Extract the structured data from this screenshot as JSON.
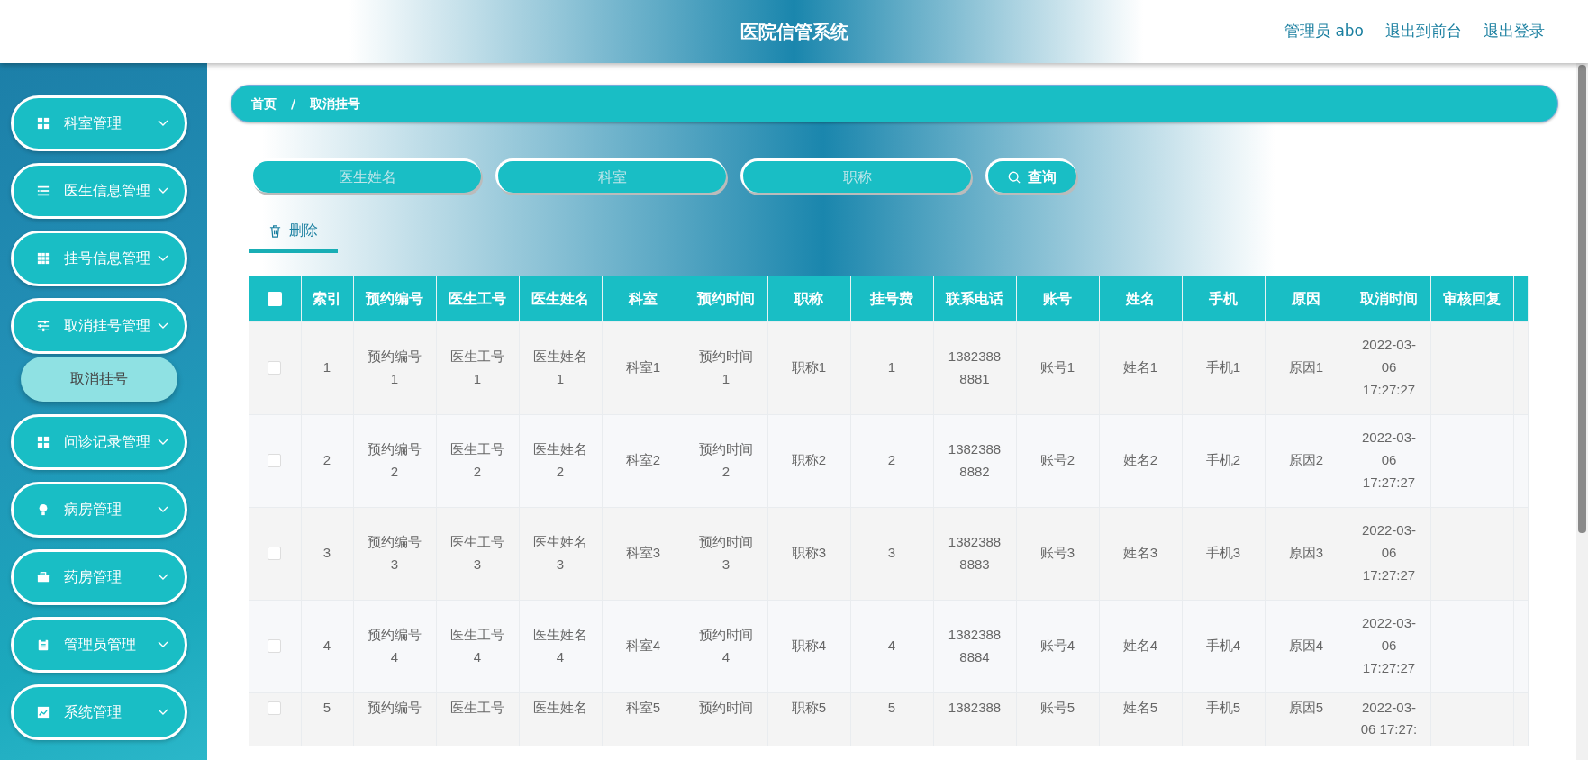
{
  "header": {
    "title": "医院信管系统",
    "links": [
      "管理员 abo",
      "退出到前台",
      "退出登录"
    ]
  },
  "sidebar": {
    "items": [
      {
        "label": "科室管理"
      },
      {
        "label": "医生信息管理"
      },
      {
        "label": "挂号信息管理"
      },
      {
        "label": "取消挂号管理",
        "children": [
          {
            "label": "取消挂号",
            "selected": true
          }
        ]
      },
      {
        "label": "问诊记录管理"
      },
      {
        "label": "病房管理"
      },
      {
        "label": "药房管理"
      },
      {
        "label": "管理员管理"
      },
      {
        "label": "系统管理"
      }
    ]
  },
  "breadcrumb": {
    "items": [
      "首页",
      "取消挂号"
    ],
    "separator": "/"
  },
  "search": {
    "fields": [
      {
        "placeholder": "医生姓名"
      },
      {
        "placeholder": "科室"
      },
      {
        "placeholder": "职称"
      }
    ],
    "button": "查询"
  },
  "actions": [
    {
      "label": "删除",
      "selected": true
    }
  ],
  "table": {
    "select_all": {
      "checked": false
    },
    "columns": [
      "索引",
      "预约编号",
      "医生工号",
      "医生姓名",
      "科室",
      "预约时间",
      "职称",
      "挂号费",
      "联系电话",
      "账号",
      "姓名",
      "手机",
      "原因",
      "取消时间",
      "审核回复"
    ],
    "rows": [
      {
        "checked": false,
        "cells": [
          "1",
          "预约编号1",
          "医生工号1",
          "医生姓名1",
          "科室1",
          "预约时间1",
          "职称1",
          "1",
          "13823888881",
          "账号1",
          "姓名1",
          "手机1",
          "原因1",
          "2022-03-06 17:27:27",
          ""
        ]
      },
      {
        "checked": false,
        "cells": [
          "2",
          "预约编号2",
          "医生工号2",
          "医生姓名2",
          "科室2",
          "预约时间2",
          "职称2",
          "2",
          "13823888882",
          "账号2",
          "姓名2",
          "手机2",
          "原因2",
          "2022-03-06 17:27:27",
          ""
        ]
      },
      {
        "checked": false,
        "cells": [
          "3",
          "预约编号3",
          "医生工号3",
          "医生姓名3",
          "科室3",
          "预约时间3",
          "职称3",
          "3",
          "13823888883",
          "账号3",
          "姓名3",
          "手机3",
          "原因3",
          "2022-03-06 17:27:27",
          ""
        ]
      },
      {
        "checked": false,
        "cells": [
          "4",
          "预约编号4",
          "医生工号4",
          "医生姓名4",
          "科室4",
          "预约时间4",
          "职称4",
          "4",
          "13823888884",
          "账号4",
          "姓名4",
          "手机4",
          "原因4",
          "2022-03-06 17:27:27",
          ""
        ]
      },
      {
        "checked": false,
        "cells": [
          "5",
          "预约编号",
          "医生工号",
          "医生姓名",
          "科室5",
          "预约时间",
          "职称5",
          "5",
          "1382388",
          "账号5",
          "姓名5",
          "手机5",
          "原因5",
          "2022-03-06 17:27:",
          ""
        ]
      }
    ]
  }
}
